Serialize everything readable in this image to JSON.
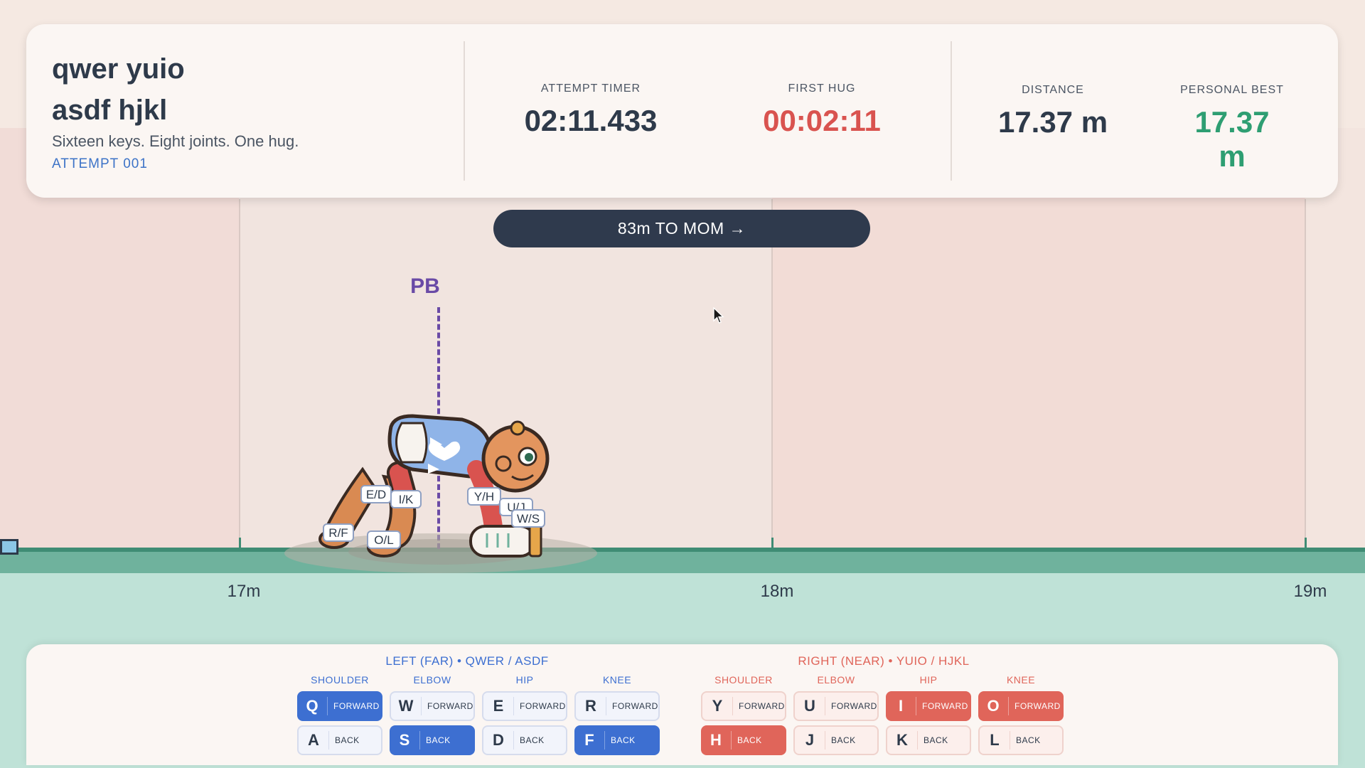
{
  "hud": {
    "title_line1": "qwer yuio",
    "title_line2": "asdf hjkl",
    "subtitle": "Sixteen keys. Eight joints. One hug.",
    "attempt": "ATTEMPT  001",
    "attempt_timer_label": "ATTEMPT TIMER",
    "attempt_timer_value": "02:11.433",
    "first_hug_label": "FIRST HUG",
    "first_hug_value": "00:02:11",
    "distance_label": "DISTANCE",
    "distance_value": "17.37 m",
    "pb_label": "PERSONAL BEST",
    "pb_value": "17.37 m"
  },
  "banner": {
    "text": "83m TO MOM  →"
  },
  "track": {
    "pb_marker": "PB",
    "distance_labels": [
      "17m",
      "18m",
      "19m"
    ]
  },
  "limb_labels": [
    "E/D",
    "I/K",
    "R/F",
    "O/L",
    "Y/H",
    "U/J",
    "W/S"
  ],
  "controls": {
    "left_title": "LEFT (FAR)  •  QWER / ASDF",
    "right_title": "RIGHT (NEAR)  •  YUIO / HJKL",
    "left": [
      {
        "joint": "SHOULDER",
        "fwd_key": "Q",
        "back_key": "A",
        "fwd_active": true,
        "back_active": false
      },
      {
        "joint": "ELBOW",
        "fwd_key": "W",
        "back_key": "S",
        "fwd_active": false,
        "back_active": true
      },
      {
        "joint": "HIP",
        "fwd_key": "E",
        "back_key": "D",
        "fwd_active": false,
        "back_active": false
      },
      {
        "joint": "KNEE",
        "fwd_key": "R",
        "back_key": "F",
        "fwd_active": false,
        "back_active": true
      }
    ],
    "right": [
      {
        "joint": "SHOULDER",
        "fwd_key": "Y",
        "back_key": "H",
        "fwd_active": false,
        "back_active": true
      },
      {
        "joint": "ELBOW",
        "fwd_key": "U",
        "back_key": "J",
        "fwd_active": false,
        "back_active": false
      },
      {
        "joint": "HIP",
        "fwd_key": "I",
        "back_key": "K",
        "fwd_active": true,
        "back_active": false
      },
      {
        "joint": "KNEE",
        "fwd_key": "O",
        "back_key": "L",
        "fwd_active": true,
        "back_active": false
      }
    ],
    "forward_word": "FORWARD",
    "back_word": "BACK"
  },
  "colors": {
    "left_accent": "#3d6fd1",
    "right_accent": "#e0655a",
    "first_hug": "#d9534f",
    "personal_best": "#2e9e72",
    "pb_marker": "#6a4aa6"
  },
  "icons": [
    "arrow-right-icon",
    "mouse-cursor-icon",
    "baby-character"
  ]
}
